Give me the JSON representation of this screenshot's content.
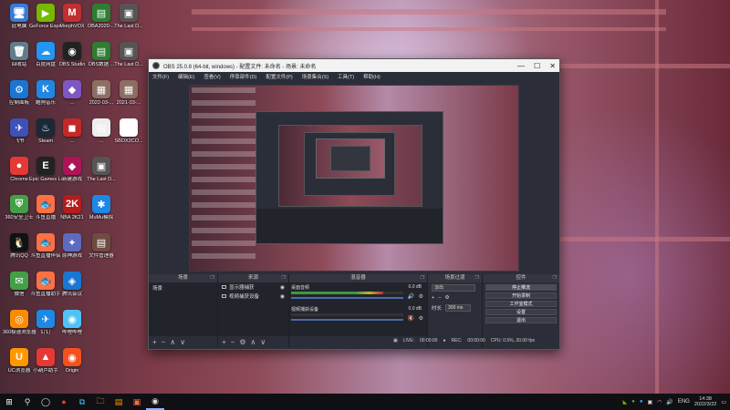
{
  "desktop": {
    "icons": [
      {
        "label": "此电脑",
        "glyph": "🖥",
        "color": "#3a7bd5"
      },
      {
        "label": "GeForce Experience",
        "glyph": "▶",
        "color": "#76b900"
      },
      {
        "label": "MorphVOX",
        "glyph": "M",
        "color": "#c03030"
      },
      {
        "label": "OBA2020-...",
        "glyph": "▤",
        "color": "#2e7d32"
      },
      {
        "label": "The Last D...",
        "glyph": "▣",
        "color": "#555"
      },
      {
        "label": "回收站",
        "glyph": "🗑",
        "color": "#607d8b"
      },
      {
        "label": "百度网盘",
        "glyph": "☁",
        "color": "#2196f3"
      },
      {
        "label": "OBS Studio",
        "glyph": "◉",
        "color": "#222"
      },
      {
        "label": "OBS数据 ...",
        "glyph": "▤",
        "color": "#2e7d32"
      },
      {
        "label": "The Last D...",
        "glyph": "▣",
        "color": "#555"
      },
      {
        "label": "控制面板",
        "glyph": "⚙",
        "color": "#1976d2"
      },
      {
        "label": "酷狗音乐",
        "glyph": "K",
        "color": "#1e88e5"
      },
      {
        "label": "...",
        "glyph": "◆",
        "color": "#7e57c2"
      },
      {
        "label": "2022-03-...",
        "glyph": "▦",
        "color": "#8d6e63"
      },
      {
        "label": "2021-03-...",
        "glyph": "▦",
        "color": "#8d6e63"
      },
      {
        "label": "飞书",
        "glyph": "✈",
        "color": "#3f51b5"
      },
      {
        "label": "Steam",
        "glyph": "♨",
        "color": "#1b2838"
      },
      {
        "label": "...",
        "glyph": "◼",
        "color": "#c62828"
      },
      {
        "label": "...",
        "glyph": "▤",
        "color": "#eee"
      },
      {
        "label": "SBOX2CO...",
        "glyph": "▤",
        "color": "#fff"
      },
      {
        "label": "Chrome",
        "glyph": "●",
        "color": "#e53935"
      },
      {
        "label": "Epic Games Launcher",
        "glyph": "E",
        "color": "#222"
      },
      {
        "label": "新建游戏",
        "glyph": "◆",
        "color": "#ad1457"
      },
      {
        "label": "The Last D...",
        "glyph": "▣",
        "color": "#555"
      },
      {
        "label": "360安全卫士",
        "glyph": "⛨",
        "color": "#43a047"
      },
      {
        "label": "斗鱼直播",
        "glyph": "🐟",
        "color": "#ff7043"
      },
      {
        "label": "NBA 2K21",
        "glyph": "2K",
        "color": "#b71c1c"
      },
      {
        "label": "MuMu模拟",
        "glyph": "✱",
        "color": "#1e88e5"
      },
      {
        "label": "腾讯QQ",
        "glyph": "🐧",
        "color": "#111"
      },
      {
        "label": "斗鱼直播伴侣",
        "glyph": "🐟",
        "color": "#ff7043"
      },
      {
        "label": "原神游戏",
        "glyph": "✦",
        "color": "#5c6bc0"
      },
      {
        "label": "文件管理器",
        "glyph": "▤",
        "color": "#6d4c41"
      },
      {
        "label": "微信",
        "glyph": "✉",
        "color": "#43a047"
      },
      {
        "label": "斗鱼直播助手",
        "glyph": "🐟",
        "color": "#ff7043"
      },
      {
        "label": "腾讯会议",
        "glyph": "◈",
        "color": "#1976d2"
      },
      {
        "label": "360极速浏览器",
        "glyph": "◎",
        "color": "#fb8c00"
      },
      {
        "label": "钉钉",
        "glyph": "✈",
        "color": "#1e88e5"
      },
      {
        "label": "哔哩哔哩",
        "glyph": "◉",
        "color": "#4fc3f7"
      },
      {
        "label": "UC浏览器",
        "glyph": "U",
        "color": "#ff9800"
      },
      {
        "label": "小葫芦助手",
        "glyph": "▲",
        "color": "#e53935"
      },
      {
        "label": "Origin",
        "glyph": "◉",
        "color": "#f4511e"
      }
    ]
  },
  "obs": {
    "title": "OBS 25.0.8 (64-bit, windows) - 配置文件: 未命名 - 场景: 未命名",
    "window_controls": [
      "—",
      "☐",
      "✕"
    ],
    "menu": [
      "文件(F)",
      "编辑(E)",
      "查看(V)",
      "停靠部件(D)",
      "配置文件(P)",
      "场景集合(S)",
      "工具(T)",
      "帮助(H)"
    ],
    "docks": {
      "scenes": {
        "title": "场景",
        "items": [
          "场景"
        ]
      },
      "sources": {
        "title": "来源",
        "items": [
          "显示器捕获",
          "视频捕获设备"
        ]
      },
      "mixer": {
        "title": "混音器",
        "channels": [
          {
            "name": "桌面音频",
            "db": "0.0 dB",
            "level": 0.82
          },
          {
            "name": "视频捕获设备",
            "db": "0.0 dB",
            "level": 0.0
          }
        ]
      },
      "transitions": {
        "title": "场景过渡",
        "type": "淡出",
        "duration_label": "时长",
        "duration": "300 ms"
      },
      "controls": {
        "title": "控件",
        "buttons": [
          "停止推流",
          "开始录制",
          "工作室模式",
          "设置",
          "退出"
        ]
      }
    },
    "status": {
      "live_label": "LIVE:",
      "live_time": "00:00:00",
      "rec_label": "REC:",
      "rec_time": "00:00:00",
      "cpu": "CPU: 0.5%, 30.00 fps"
    }
  },
  "taskbar": {
    "items": [
      "⊞",
      "⚲",
      "◯",
      "●",
      "⧉",
      "🗀",
      "▤",
      "▣",
      "◉"
    ],
    "tray_lang": "ENG",
    "time": "14:38",
    "date": "2022/3/22"
  },
  "colors": {
    "obs_bg": "#2b2e38",
    "accent": "#4a6ab0"
  }
}
